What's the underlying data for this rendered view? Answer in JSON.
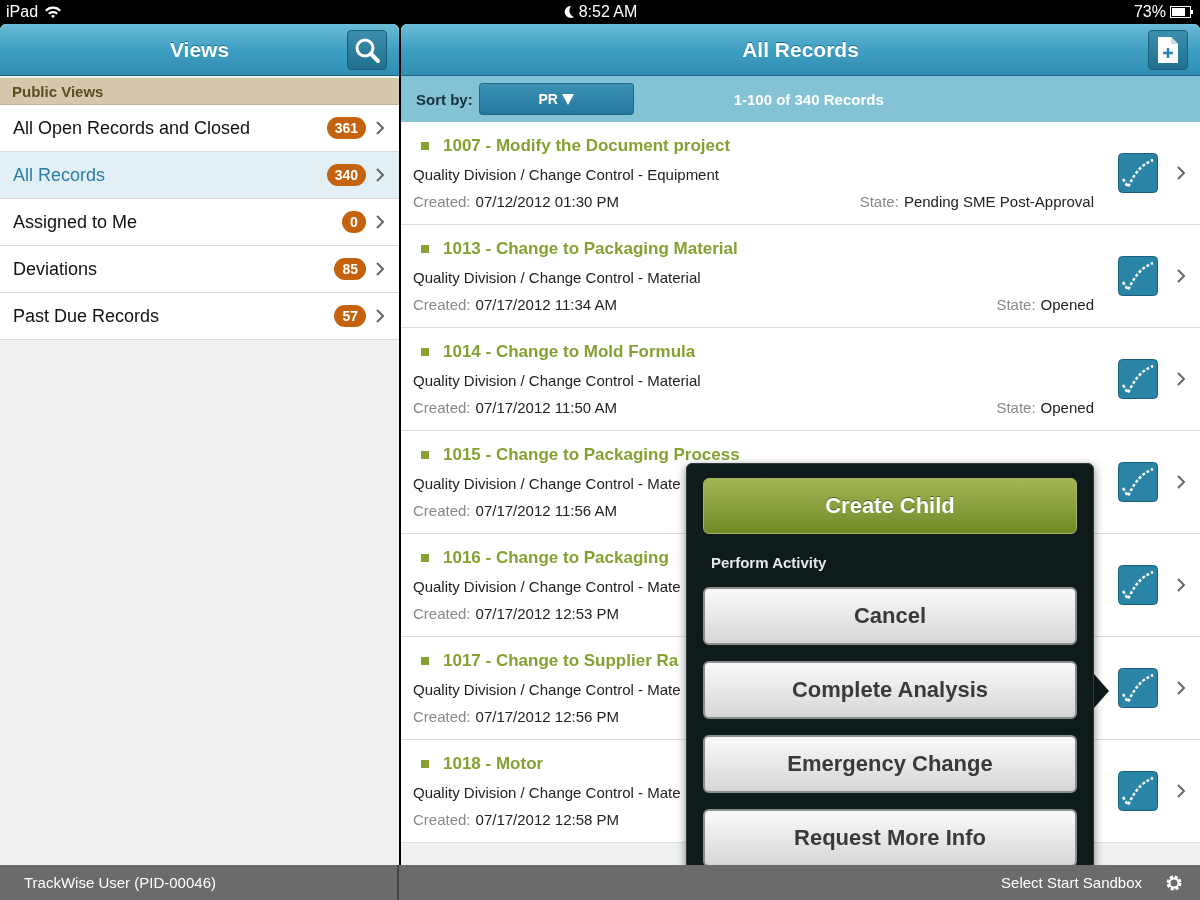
{
  "status_bar": {
    "device": "iPad",
    "time": "8:52 AM",
    "battery": "73%"
  },
  "views_panel": {
    "title": "Views",
    "section": "Public Views",
    "items": [
      {
        "label": "All Open Records and Closed",
        "count": "361",
        "selected": false
      },
      {
        "label": "All Records",
        "count": "340",
        "selected": true
      },
      {
        "label": "Assigned to Me",
        "count": "0",
        "selected": false
      },
      {
        "label": "Deviations",
        "count": "85",
        "selected": false
      },
      {
        "label": "Past Due Records",
        "count": "57",
        "selected": false
      }
    ]
  },
  "records_panel": {
    "title": "All Records",
    "sort_label": "Sort by:",
    "sort_value": "PR",
    "range": "1-100 of 340 Records",
    "records": [
      {
        "title": "1007 - Modify the Document project",
        "path": "Quality Division / Change Control - Equipment",
        "created_label": "Created:",
        "created": "07/12/2012 01:30 PM",
        "state_label": "State:",
        "state": "Pending SME Post-Approval"
      },
      {
        "title": "1013 - Change to Packaging Material",
        "path": "Quality Division / Change Control - Material",
        "created_label": "Created:",
        "created": "07/17/2012 11:34 AM",
        "state_label": "State:",
        "state": "Opened"
      },
      {
        "title": "1014 - Change to Mold Formula",
        "path": "Quality Division / Change Control - Material",
        "created_label": "Created:",
        "created": "07/17/2012 11:50 AM",
        "state_label": "State:",
        "state": "Opened"
      },
      {
        "title": "1015 - Change to Packaging Process",
        "path": "Quality Division / Change Control - Mate",
        "created_label": "Created:",
        "created": "07/17/2012 11:56 AM"
      },
      {
        "title": "1016 - Change to Packaging",
        "path": "Quality Division / Change Control - Mate",
        "created_label": "Created:",
        "created": "07/17/2012 12:53 PM"
      },
      {
        "title": "1017 - Change to Supplier Ra",
        "path": "Quality Division / Change Control - Mate",
        "created_label": "Created:",
        "created": "07/17/2012 12:56 PM"
      },
      {
        "title": "1018 - Motor",
        "path": "Quality Division / Change Control - Mate",
        "created_label": "Created:",
        "created": "07/17/2012 12:58 PM"
      }
    ]
  },
  "popover": {
    "primary": "Create Child",
    "section": "Perform Activity",
    "actions": [
      "Cancel",
      "Complete Analysis",
      "Emergency Change",
      "Request More Info"
    ]
  },
  "footer": {
    "user": "TrackWise User (PID-00046)",
    "environment": "Select Start Sandbox"
  }
}
